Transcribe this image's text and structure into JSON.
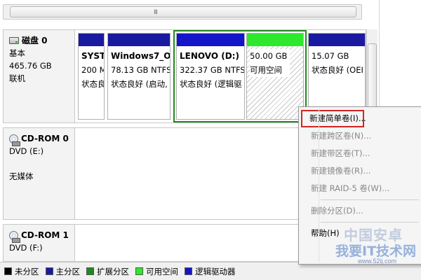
{
  "hscroll": {
    "grip": "III"
  },
  "disks": [
    {
      "name": "磁盘 0",
      "type": "基本",
      "size": "465.76 GB",
      "status": "联机",
      "icon": "hard-disk-icon"
    }
  ],
  "partitions": [
    {
      "name": "SYSTI",
      "size": "200 M",
      "status": "状态良",
      "color": "#1a1aa0"
    },
    {
      "name": "Windows7_OS",
      "size": "78.13 GB NTFS",
      "status": "状态良好 (启动,",
      "color": "#1a1aa0"
    },
    {
      "name": "LENOVO  (D:)",
      "size": "322.37 GB NTFS",
      "status": "状态良好 (逻辑驱",
      "color": "#1414c8"
    },
    {
      "name": "",
      "size": "50.00 GB",
      "status": "可用空间",
      "color": "#2ee82e"
    },
    {
      "name": "",
      "size": "15.07 GB",
      "status": "状态良好 (OEI",
      "color": "#1a1aa0"
    }
  ],
  "cdroms": [
    {
      "name": "CD-ROM 0",
      "drive": "DVD (E:)",
      "media": "无媒体",
      "icon": "cd-rom-icon"
    },
    {
      "name": "CD-ROM 1",
      "drive": "DVD (F:)",
      "icon": "cd-rom-icon"
    }
  ],
  "legend": [
    {
      "label": "未分区",
      "color": "#000000"
    },
    {
      "label": "主分区",
      "color": "#1a1aa0"
    },
    {
      "label": "扩展分区",
      "color": "#1e8a1e"
    },
    {
      "label": "可用空间",
      "color": "#2ee82e"
    },
    {
      "label": "逻辑驱动器",
      "color": "#1414c8"
    }
  ],
  "context_menu": {
    "items": [
      {
        "label": "新建简单卷(I)...",
        "enabled": true,
        "highlighted": true
      },
      {
        "label": "新建跨区卷(N)...",
        "enabled": false
      },
      {
        "label": "新建带区卷(T)...",
        "enabled": false
      },
      {
        "label": "新建镜像卷(R)...",
        "enabled": false
      },
      {
        "label": "新建 RAID-5 卷(W)...",
        "enabled": false
      },
      {
        "label": "删除分区(D)...",
        "enabled": false
      },
      {
        "label": "帮助(H)",
        "enabled": true
      }
    ]
  },
  "watermark": {
    "top": "中国安卓",
    "main": "我要IT技术网",
    "url": "www.52ij.com"
  }
}
